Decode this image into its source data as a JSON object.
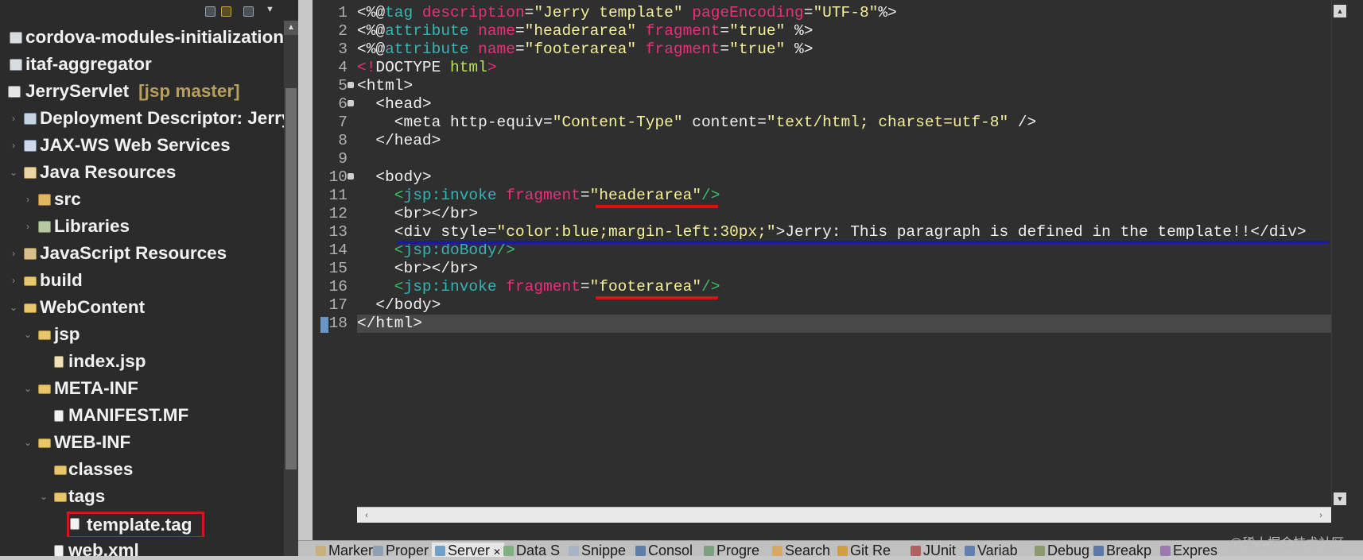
{
  "explorer": {
    "items": [
      {
        "label": "cordova-modules-initialization",
        "decoration": "",
        "icon": "project-icon"
      },
      {
        "label": "itaf-aggregator",
        "decoration": "",
        "icon": "project-icon"
      },
      {
        "label": "JerryServlet",
        "decoration": "[jsp master]",
        "icon": "web-project-icon"
      },
      {
        "label": "Deployment Descriptor: Jerry",
        "decoration": "",
        "icon": "deployment-descriptor-icon"
      },
      {
        "label": "JAX-WS Web Services",
        "decoration": "",
        "icon": "web-services-icon"
      },
      {
        "label": "Java Resources",
        "decoration": "",
        "icon": "java-resources-icon"
      },
      {
        "label": "src",
        "decoration": "",
        "icon": "package-folder-icon"
      },
      {
        "label": "Libraries",
        "decoration": "",
        "icon": "library-icon"
      },
      {
        "label": "JavaScript Resources",
        "decoration": "",
        "icon": "javascript-resources-icon"
      },
      {
        "label": "build",
        "decoration": "",
        "icon": "folder-icon"
      },
      {
        "label": "WebContent",
        "decoration": "",
        "icon": "folder-icon"
      },
      {
        "label": "jsp",
        "decoration": "",
        "icon": "folder-icon"
      },
      {
        "label": "index.jsp",
        "decoration": "",
        "icon": "jsp-file-icon"
      },
      {
        "label": "META-INF",
        "decoration": "",
        "icon": "folder-icon"
      },
      {
        "label": "MANIFEST.MF",
        "decoration": "",
        "icon": "file-icon"
      },
      {
        "label": "WEB-INF",
        "decoration": "",
        "icon": "folder-icon"
      },
      {
        "label": "classes",
        "decoration": "",
        "icon": "folder-icon"
      },
      {
        "label": "tags",
        "decoration": "",
        "icon": "folder-icon"
      },
      {
        "label": "template.tag",
        "decoration": "",
        "icon": "file-icon"
      },
      {
        "label": "web.xml",
        "decoration": "",
        "icon": "file-icon"
      }
    ],
    "highlighted_item": "template.tag"
  },
  "editor": {
    "line_numbers": [
      "1",
      "2",
      "3",
      "4",
      "5",
      "6",
      "7",
      "8",
      "9",
      "10",
      "11",
      "12",
      "13",
      "14",
      "15",
      "16",
      "17",
      "18"
    ],
    "current_line": "18",
    "lines": {
      "l1": {
        "a": "<%@",
        "b": "tag",
        "c": " ",
        "d": "description",
        "e": "=",
        "f": "\"Jerry template\"",
        "g": " ",
        "h": "pageEncoding",
        "i": "=",
        "j": "\"UTF-8\"",
        "k": "%>"
      },
      "l2": {
        "a": "<%@",
        "b": "attribute",
        "c": " ",
        "d": "name",
        "e": "=",
        "f": "\"headerarea\"",
        "g": " ",
        "h": "fragment",
        "i": "=",
        "j": "\"true\"",
        "k": " %>"
      },
      "l3": {
        "a": "<%@",
        "b": "attribute",
        "c": " ",
        "d": "name",
        "e": "=",
        "f": "\"footerarea\"",
        "g": " ",
        "h": "fragment",
        "i": "=",
        "j": "\"true\"",
        "k": " %>"
      },
      "l4": {
        "a": "<!",
        "b": "DOCTYPE",
        "c": " html",
        "d": ">"
      },
      "l5": {
        "a": "<html>"
      },
      "l6": {
        "a": "  <head>"
      },
      "l7": {
        "a": "    <meta http-equiv=",
        "b": "\"Content-Type\"",
        "c": " content=",
        "d": "\"text/html; charset=utf-8\"",
        "e": " />"
      },
      "l8": {
        "a": "  </head>"
      },
      "l9": {
        "a": ""
      },
      "l10": {
        "a": "  <body>"
      },
      "l11": {
        "a": "    <",
        "b": "jsp",
        "c": ":invoke",
        "d": " fragment",
        "e": "=",
        "f": "\"",
        "g": "headerarea",
        "h": "\"",
        "i": "/>"
      },
      "l12": {
        "a": "    <br></br>"
      },
      "l13": {
        "a": "    <div style=",
        "b": "\"color:blue;margin-left:30px;\"",
        "c": ">Jerry: This paragraph is defined in the template!!</div>"
      },
      "l14": {
        "a": "    <",
        "b": "jsp:doBody",
        "c": "/>"
      },
      "l15": {
        "a": "    <br></br>"
      },
      "l16": {
        "a": "    <",
        "b": "jsp",
        "c": ":invoke",
        "d": " fragment",
        "e": "=",
        "f": "\"",
        "g": "footerarea",
        "h": "\"",
        "i": "/>"
      },
      "l17": {
        "a": "  </body>"
      },
      "l18": {
        "a": "</html>"
      }
    }
  },
  "view_tabs": [
    {
      "label": "Marker",
      "icon": "markers-icon"
    },
    {
      "label": "Proper",
      "icon": "properties-icon"
    },
    {
      "label": "Server",
      "icon": "servers-icon",
      "active": true,
      "close": "✕"
    },
    {
      "label": "Data S",
      "icon": "data-source-icon"
    },
    {
      "label": "Snippe",
      "icon": "snippets-icon"
    },
    {
      "label": "Consol",
      "icon": "console-icon"
    },
    {
      "label": "Progre",
      "icon": "progress-icon"
    },
    {
      "label": "Search",
      "icon": "search-icon"
    },
    {
      "label": "Git Re",
      "icon": "git-repositories-icon"
    },
    {
      "label": "JUnit",
      "icon": "junit-icon"
    },
    {
      "label": "Variab",
      "icon": "variables-icon"
    },
    {
      "label": "Debug",
      "icon": "debug-icon"
    },
    {
      "label": "Breakp",
      "icon": "breakpoints-icon"
    },
    {
      "label": "Expres",
      "icon": "expressions-icon"
    }
  ],
  "watermark": "@稀土掘金技术社区",
  "colors": {
    "keyword": "#34b4b4",
    "attribute": "#e8307a",
    "string": "#f5f09a",
    "namespace": "#3cbf64",
    "annotation_red": "#e01010",
    "annotation_blue": "#1b1b9e",
    "highlight_box": "#d01818"
  }
}
